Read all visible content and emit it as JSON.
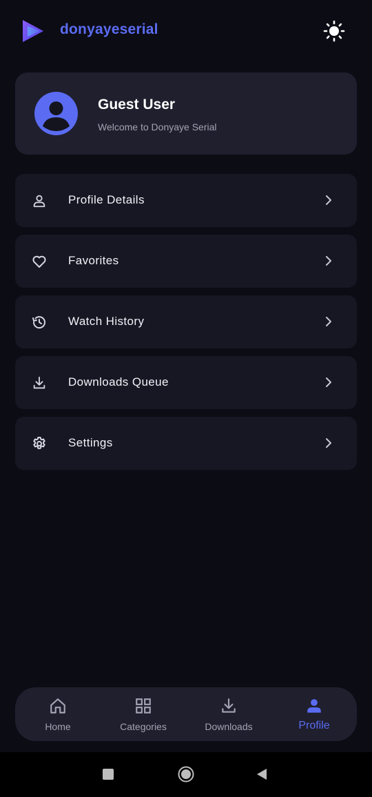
{
  "header": {
    "brand": "donyayeserial",
    "logo_icon": "play-logo-icon",
    "theme_icon": "sun-icon"
  },
  "profile": {
    "name": "Guest User",
    "welcome": "Welcome to Donyaye Serial",
    "avatar_icon": "user-avatar-icon"
  },
  "menu": {
    "items": [
      {
        "label": "Profile Details",
        "icon": "user-icon"
      },
      {
        "label": "Favorites",
        "icon": "heart-icon"
      },
      {
        "label": "Watch History",
        "icon": "history-icon"
      },
      {
        "label": "Downloads Queue",
        "icon": "download-icon"
      },
      {
        "label": "Settings",
        "icon": "gear-icon"
      }
    ]
  },
  "bottom_nav": {
    "items": [
      {
        "label": "Home",
        "icon": "home-icon",
        "active": false
      },
      {
        "label": "Categories",
        "icon": "grid-icon",
        "active": false
      },
      {
        "label": "Downloads",
        "icon": "download-icon",
        "active": false
      },
      {
        "label": "Profile",
        "icon": "person-icon",
        "active": true
      }
    ]
  },
  "system_nav": {
    "buttons": [
      "recents-square-icon",
      "home-circle-icon",
      "back-triangle-icon"
    ]
  },
  "colors": {
    "background": "#0c0c15",
    "card": "#1f1f2e",
    "menu_item": "#171724",
    "accent": "#5b6cf2",
    "muted_text": "#a3a3b3"
  }
}
